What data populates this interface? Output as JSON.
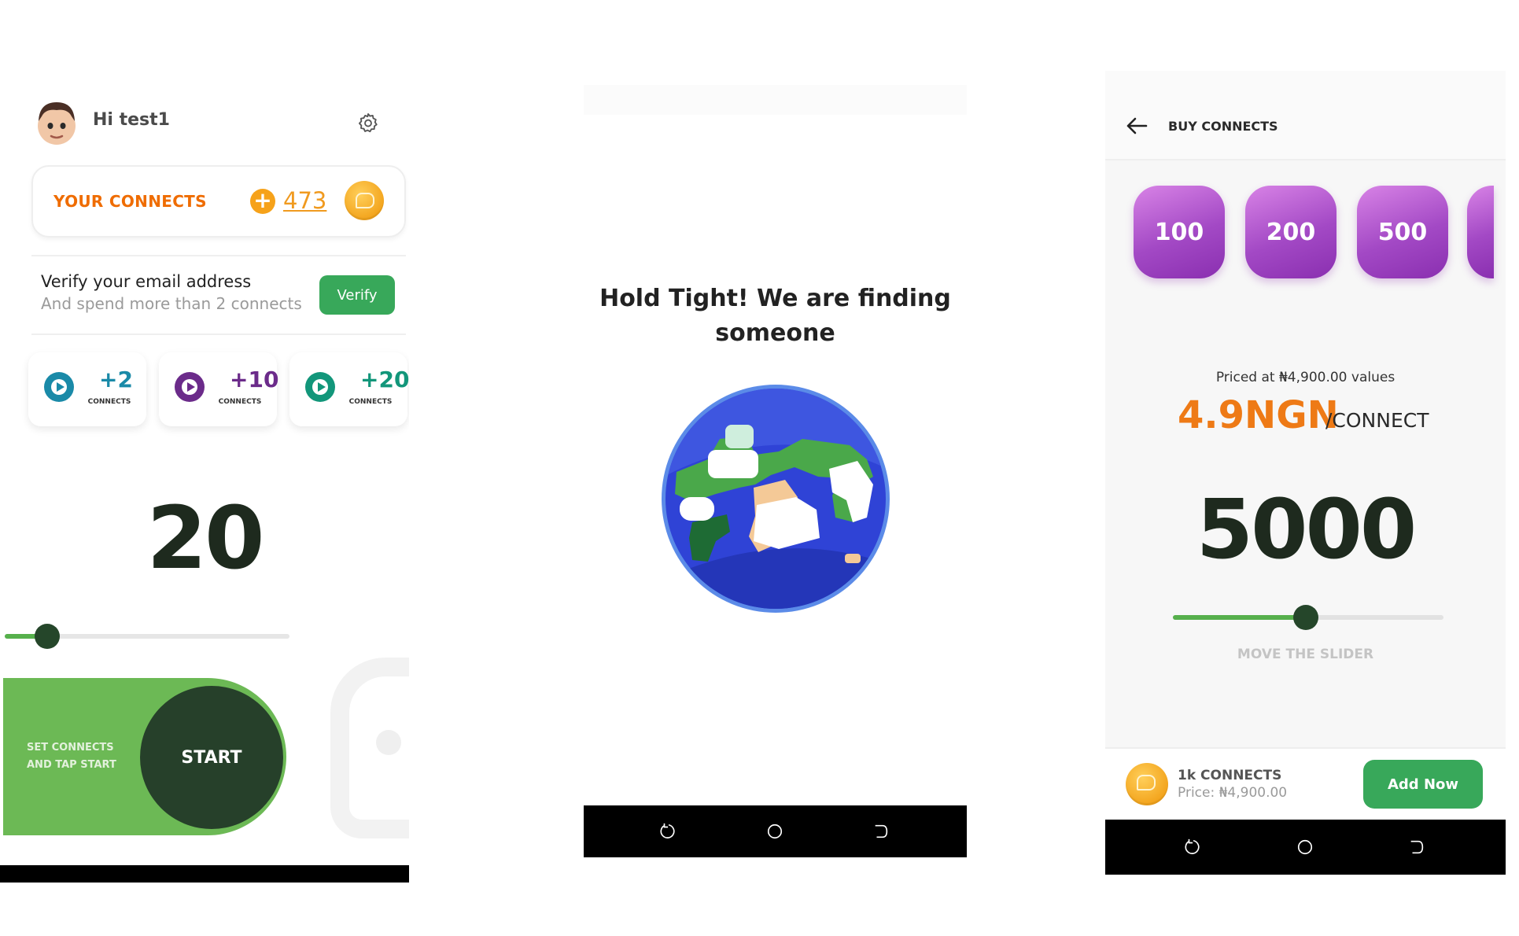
{
  "screen1": {
    "greeting": "Hi test1",
    "connects_label": "YOUR CONNECTS",
    "connects_count": "473",
    "verify": {
      "title": "Verify your email address",
      "subtitle": "And spend more than 2 connects",
      "button": "Verify"
    },
    "rewards": [
      {
        "amount": "+2",
        "unit": "CONNECTS",
        "color": "#1a8aa8"
      },
      {
        "amount": "+10",
        "unit": "CONNECTS",
        "color": "#6b2b8a"
      },
      {
        "amount": "+20",
        "unit": "CONNECTS",
        "color": "#12967a"
      }
    ],
    "selected_connects": "20",
    "slider_fraction": 0.15,
    "start_hint": "SET CONNECTS AND TAP START",
    "start_button": "START",
    "icons": [
      "avatar",
      "gear-icon",
      "plus-icon",
      "coin-icon",
      "play-icon"
    ]
  },
  "screen2": {
    "message": "Hold Tight! We are finding someone",
    "nav_icons": [
      "recent-apps-icon",
      "home-icon",
      "back-icon"
    ]
  },
  "screen3": {
    "title": "BUY CONNECTS",
    "packs": [
      "100",
      "200",
      "500"
    ],
    "priced_text": "Priced at ₦4,900.00 values",
    "rate": "4.9NGN",
    "rate_unit": "/CONNECT",
    "selected_amount": "5000",
    "slider_fraction": 0.49,
    "slider_hint": "MOVE THE SLIDER",
    "footer": {
      "title": "1k CONNECTS",
      "price": "Price: ₦4,900.00",
      "button": "Add Now"
    },
    "nav_icons": [
      "recent-apps-icon",
      "home-icon",
      "back-icon"
    ]
  },
  "colors": {
    "accent_green": "#38a85a",
    "slider_green": "#56b04c",
    "orange": "#ef6c00",
    "purple": "#a349c5"
  }
}
